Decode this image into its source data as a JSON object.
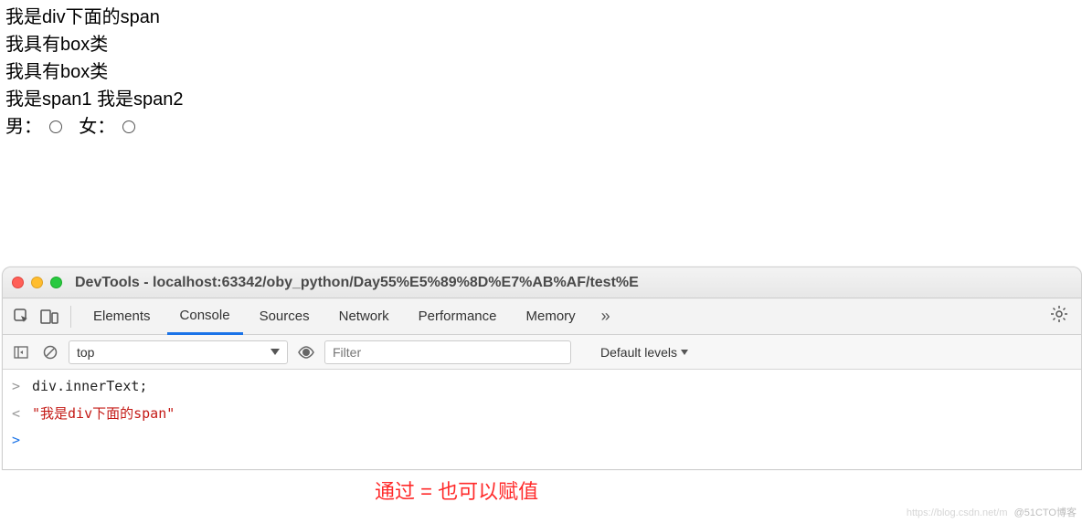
{
  "page": {
    "line1": "我是div下面的span",
    "line2": "我具有box类",
    "line3": "我具有box类",
    "span1": "我是span1",
    "span2": "我是span2",
    "male_label": "男：",
    "female_label": "女："
  },
  "window": {
    "title": "DevTools - localhost:63342/oby_python/Day55%E5%89%8D%E7%AB%AF/test%E"
  },
  "tabs": {
    "elements": "Elements",
    "console": "Console",
    "sources": "Sources",
    "network": "Network",
    "performance": "Performance",
    "memory": "Memory",
    "more": "»"
  },
  "toolbar": {
    "context": "top",
    "filter_placeholder": "Filter",
    "levels": "Default levels"
  },
  "console": {
    "input_code": "div.innerText;",
    "output_value": "\"我是div下面的span\""
  },
  "annotation": "通过 = 也可以赋值",
  "watermark": {
    "a": "https://blog.csdn.net/m",
    "b": "@51CTO博客"
  }
}
